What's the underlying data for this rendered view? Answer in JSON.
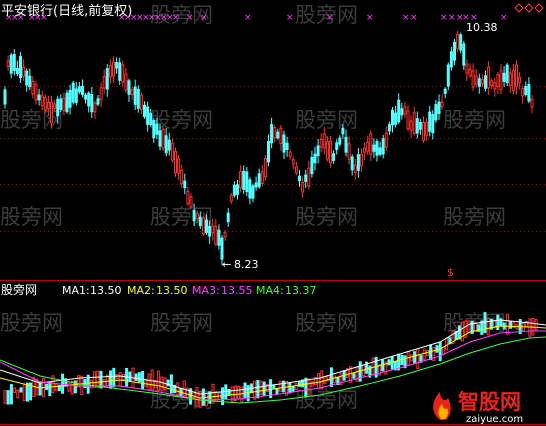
{
  "upper_panel": {
    "title": "平安银行(日线,前复权)",
    "high_label": "10.38",
    "low_label": "8.23",
    "signal_marker": "$",
    "arrow_glyph": "←",
    "up_color": "#ff3030",
    "down_color": "#54ffff",
    "x_marker_color": "#ff40ff",
    "grid_color": "#b00000"
  },
  "lower_panel": {
    "indicator_name": "股旁网",
    "ma_labels": [
      {
        "label": "MA1:",
        "value": "13.50",
        "color": "#ffffff"
      },
      {
        "label": "MA2:",
        "value": "13.50",
        "color": "#ffff00"
      },
      {
        "label": "MA3:",
        "value": "13.55",
        "color": "#ff40ff"
      },
      {
        "label": "MA4:",
        "value": "13.37",
        "color": "#40ff40"
      }
    ]
  },
  "watermark": "股旁网",
  "logo": {
    "name": "智股网",
    "url": "zaiyue.com",
    "brand_color": "#e8231a"
  },
  "chart_data": {
    "type": "candlestick",
    "labels": [
      "10.38",
      "8.23"
    ],
    "points": [
      {
        "label": "10.38",
        "value": 10.38
      },
      {
        "label": "8.23",
        "value": 8.23
      }
    ]
  }
}
